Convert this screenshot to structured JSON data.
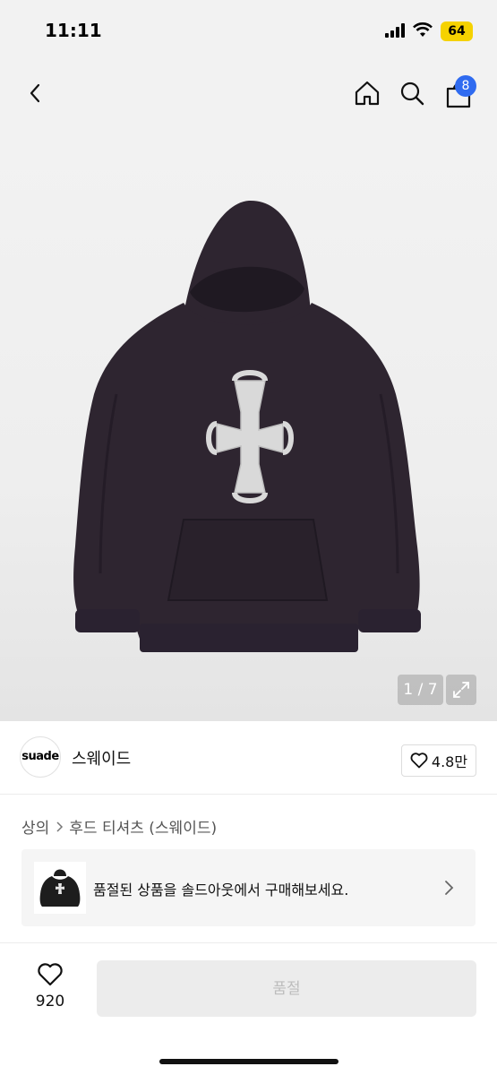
{
  "status_bar": {
    "time": "11:11",
    "battery": "64"
  },
  "header": {
    "cart_count": "8"
  },
  "gallery": {
    "counter": "1 / 7"
  },
  "brand": {
    "logo_text": "suade",
    "name": "스웨이드",
    "likes": "4.8만"
  },
  "breadcrumb": {
    "category": "상의",
    "subcategory": "후드 티셔츠 (스웨이드)"
  },
  "banner": {
    "text": "품절된 상품을 솔드아웃에서 구매해보세요."
  },
  "bottom_bar": {
    "wish_count": "920",
    "buy_label": "품절"
  },
  "colors": {
    "accent": "#2f6bf0",
    "battery": "#f5d200",
    "hoodie": "#2e2530",
    "cross": "#d9d9d9"
  }
}
